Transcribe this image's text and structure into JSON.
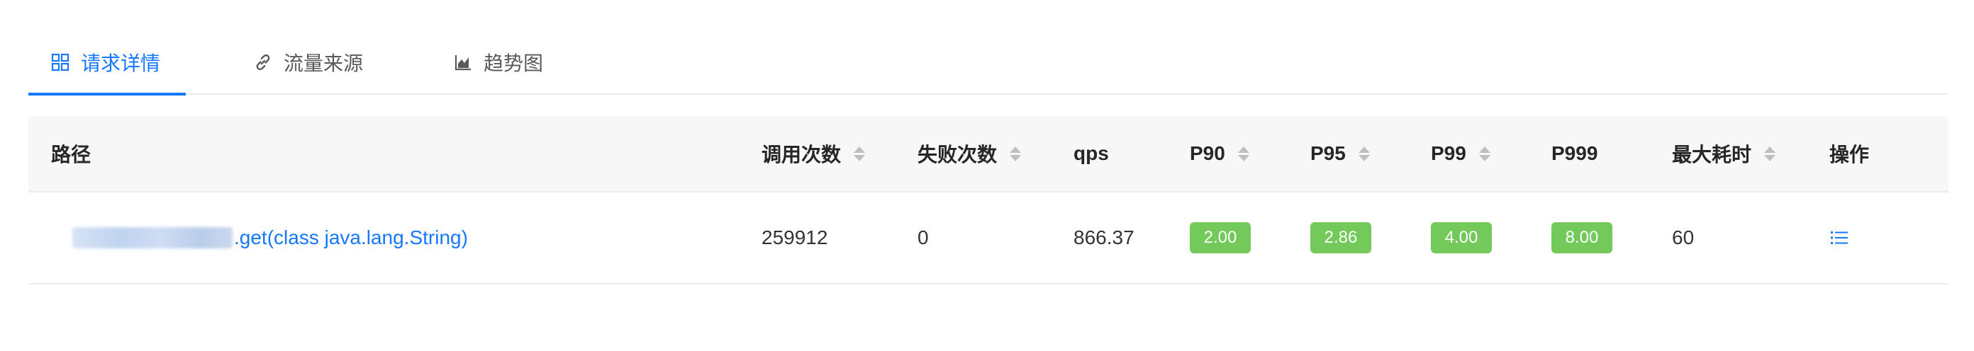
{
  "tabs": [
    {
      "label": "请求详情",
      "icon": "appstore-icon",
      "active": true
    },
    {
      "label": "流量来源",
      "icon": "link-icon",
      "active": false
    },
    {
      "label": "趋势图",
      "icon": "area-chart-icon",
      "active": false
    }
  ],
  "table": {
    "columns": [
      "路径",
      "调用次数",
      "失败次数",
      "qps",
      "P90",
      "P95",
      "P99",
      "P999",
      "最大耗时",
      "操作"
    ],
    "rows": [
      {
        "path_suffix": ".get(class java.lang.String)",
        "calls": "259912",
        "failures": "0",
        "qps": "866.37",
        "p90": "2.00",
        "p95": "2.86",
        "p99": "4.00",
        "p999": "8.00",
        "max": "60"
      }
    ]
  },
  "colors": {
    "accent": "#1677ff",
    "badge_green": "#73c95a",
    "header_bg": "#f7f7f7"
  }
}
